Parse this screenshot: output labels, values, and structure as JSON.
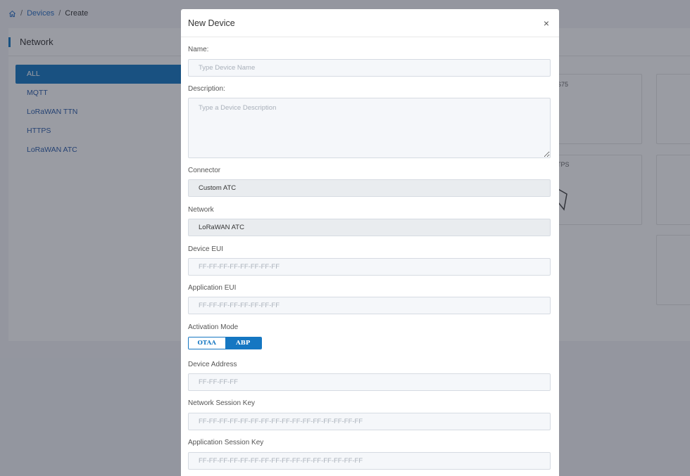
{
  "breadcrumb": {
    "devices": "Devices",
    "create": "Create",
    "separator": "/"
  },
  "panel": {
    "title": "Network"
  },
  "sidebar": {
    "items": [
      {
        "label": "ALL"
      },
      {
        "label": "MQTT"
      },
      {
        "label": "LoRaWAN TTN"
      },
      {
        "label": "HTTPS"
      },
      {
        "label": "LoRaWAN ATC"
      }
    ]
  },
  "cards": {
    "label_1": "S75",
    "label_2": "TPS"
  },
  "modal": {
    "title": "New Device",
    "close": "×",
    "name": {
      "label": "Name:",
      "placeholder": "Type Device Name"
    },
    "description": {
      "label": "Description:",
      "placeholder": "Type a Device Description"
    },
    "connector": {
      "label": "Connector",
      "value": "Custom ATC"
    },
    "network": {
      "label": "Network",
      "value": "LoRaWAN ATC"
    },
    "device_eui": {
      "label": "Device EUI",
      "placeholder": "FF-FF-FF-FF-FF-FF-FF-FF"
    },
    "application_eui": {
      "label": "Application EUI",
      "placeholder": "FF-FF-FF-FF-FF-FF-FF-FF"
    },
    "activation_mode": {
      "label": "Activation Mode",
      "otaa": "OTAA",
      "abp": "ABP",
      "selected": "ABP"
    },
    "device_address": {
      "label": "Device Address",
      "placeholder": "FF-FF-FF-FF"
    },
    "network_session_key": {
      "label": "Network Session Key",
      "placeholder": "FF-FF-FF-FF-FF-FF-FF-FF-FF-FF-FF-FF-FF-FF-FF-FF"
    },
    "application_session_key": {
      "label": "Application Session Key",
      "placeholder": "FF-FF-FF-FF-FF-FF-FF-FF-FF-FF-FF-FF-FF-FF-FF-FF"
    }
  },
  "colors": {
    "accent": "#1577c2",
    "link": "#2b5ca8"
  },
  "icons": {
    "home": "home-icon",
    "close": "close-icon"
  }
}
